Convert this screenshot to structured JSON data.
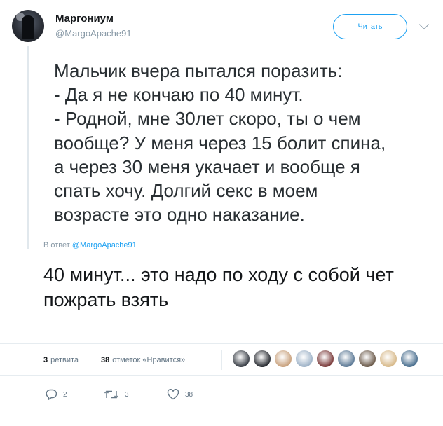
{
  "header": {
    "author_name": "Маргониум",
    "author_handle": "@MargoApache91",
    "follow_label": "Читать"
  },
  "quoted_tweet": {
    "lines": [
      "Мальчик вчера пытался поразить:",
      "- Да я не кончаю по 40 минут.",
      "- Родной, мне 30лет скоро, ты о чем",
      "вообще? У меня через 15 болит спина,",
      "а через 30 меня укачает и вообще я",
      "спать хочу. Долгий секс в моем",
      "возрасте это одно наказание."
    ]
  },
  "reply_to": {
    "prefix": "В ответ",
    "handle": "@MargoApache91"
  },
  "tweet": {
    "lines": [
      "40 минут... это надо по ходу с собой чет",
      "пожрать взять"
    ]
  },
  "stats": {
    "retweets_count": "3",
    "retweets_label": "ретвита",
    "likes_count": "38",
    "likes_label": "отметок «Нравится»",
    "liker_colors": [
      "#3a3f47",
      "#2a2d33",
      "#c9a27e",
      "#9fb3c8",
      "#7b3b3b",
      "#5d7a96",
      "#6b5a4a",
      "#d7b98a",
      "#4a6f8f"
    ]
  },
  "actions": {
    "reply_icon": "reply-icon",
    "reply_count": "2",
    "retweet_icon": "retweet-icon",
    "retweet_count": "3",
    "like_icon": "heart-icon",
    "like_count": "38"
  }
}
